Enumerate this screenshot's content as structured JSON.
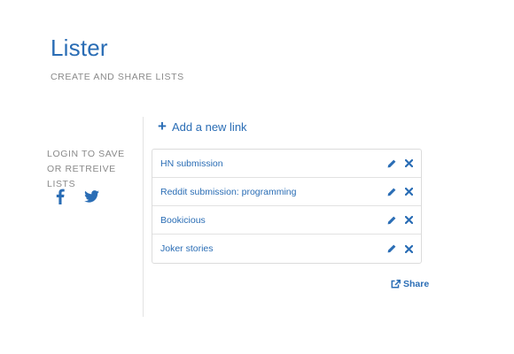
{
  "header": {
    "title": "Lister",
    "subtitle": "CREATE AND SHARE LISTS"
  },
  "sidebar": {
    "login_text": "LOGIN TO SAVE OR RETREIVE LISTS",
    "social": [
      {
        "name": "facebook",
        "icon": "facebook-icon"
      },
      {
        "name": "twitter",
        "icon": "twitter-icon"
      }
    ]
  },
  "main": {
    "add_link_label": "Add a new link",
    "items": [
      {
        "label": "HN submission"
      },
      {
        "label": "Reddit submission: programming"
      },
      {
        "label": "Bookicious"
      },
      {
        "label": "Joker stories"
      }
    ],
    "share_label": "Share"
  },
  "colors": {
    "accent": "#2a6db5",
    "muted_text": "#8a8a8a",
    "border": "#dcdcdc"
  }
}
